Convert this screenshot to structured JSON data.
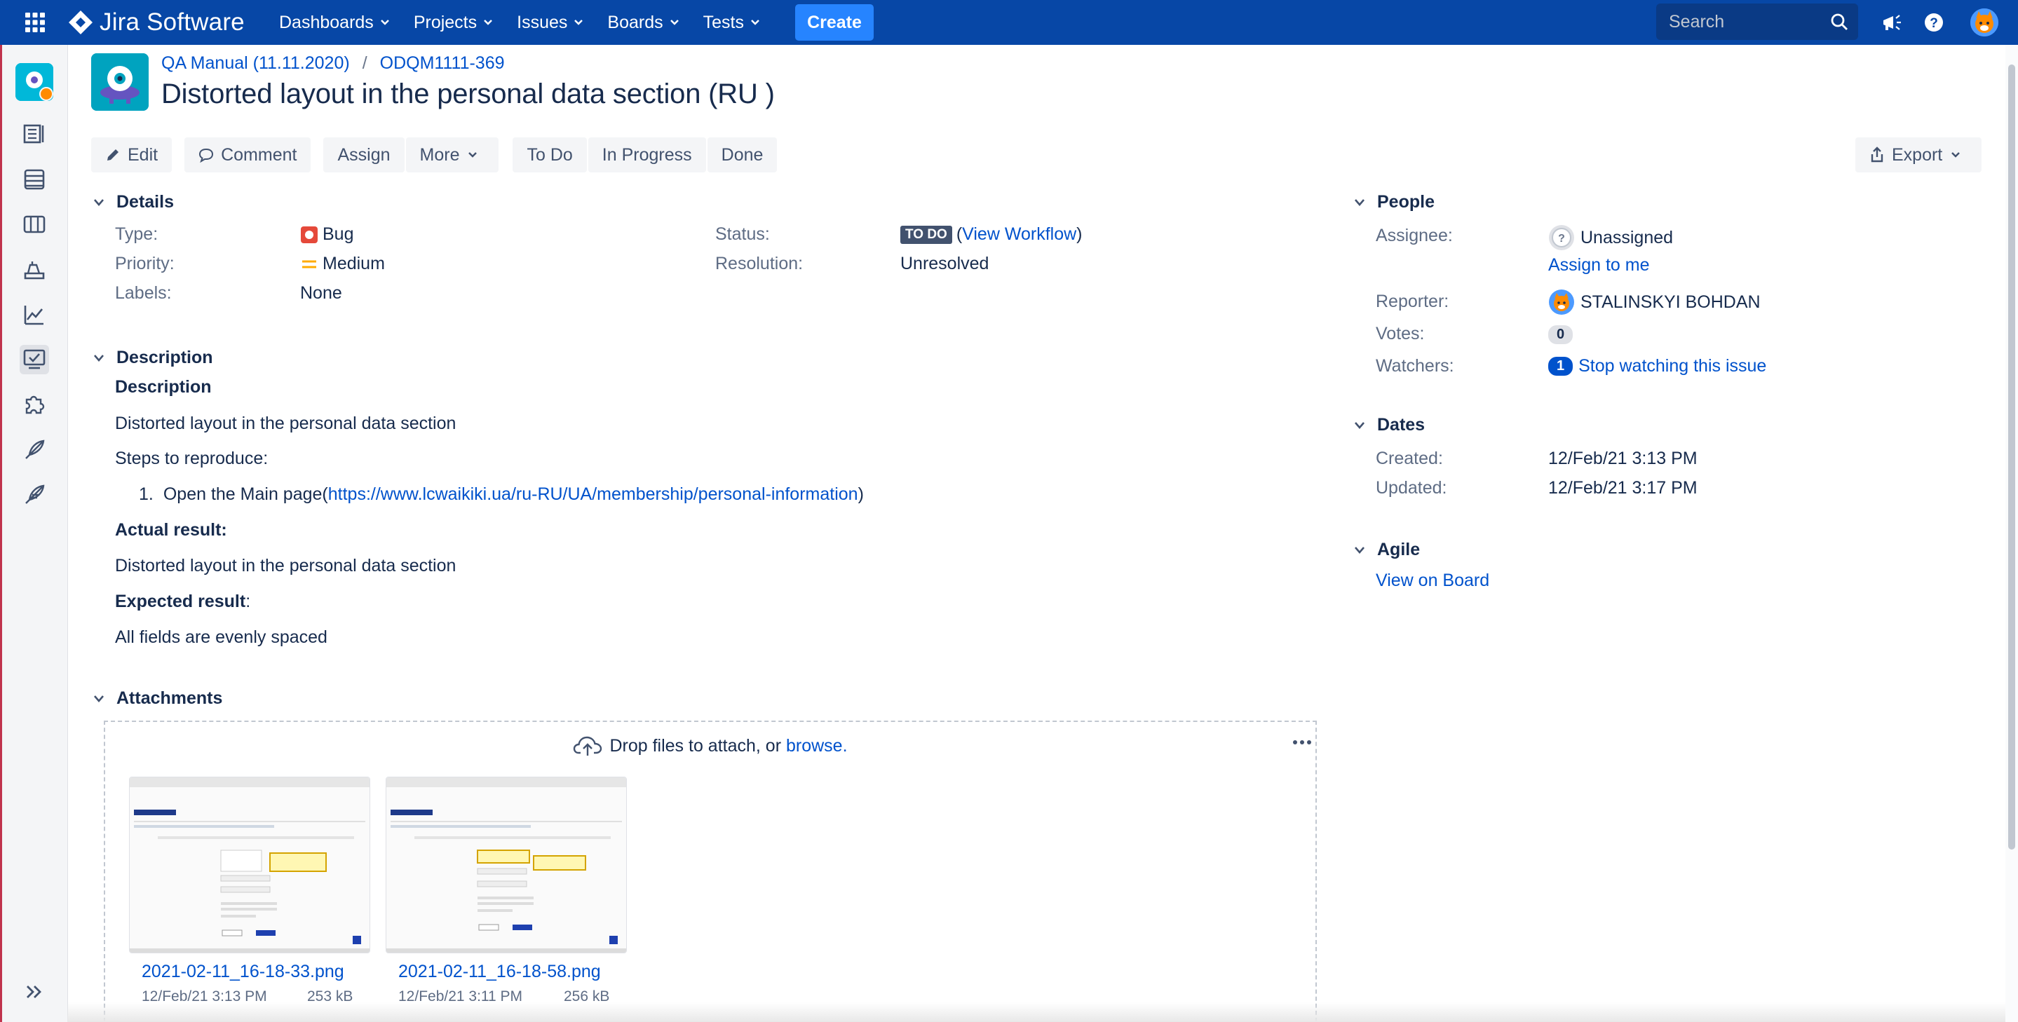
{
  "app": {
    "name": "Jira Software",
    "nav": [
      "Dashboards",
      "Projects",
      "Issues",
      "Boards",
      "Tests"
    ],
    "create_label": "Create",
    "search_placeholder": "Search"
  },
  "sidebar": {
    "icons": [
      "project-avatar",
      "backlog-icon",
      "board-list-icon",
      "board-columns-icon",
      "releases-icon",
      "reports-icon",
      "tests-icon",
      "add-ons-icon",
      "feather-icon",
      "feather-alt-icon",
      "expand-icon"
    ]
  },
  "issue": {
    "project": "QA Manual (11.11.2020)",
    "key": "ODQM1111-369",
    "title": "Distorted layout in the personal data section (RU )"
  },
  "toolbar": {
    "edit": "Edit",
    "comment": "Comment",
    "assign": "Assign",
    "more": "More",
    "todo": "To Do",
    "in_progress": "In Progress",
    "done": "Done",
    "export": "Export"
  },
  "details": {
    "heading": "Details",
    "type_label": "Type:",
    "type_value": "Bug",
    "priority_label": "Priority:",
    "priority_value": "Medium",
    "labels_label": "Labels:",
    "labels_value": "None",
    "status_label": "Status:",
    "status_lozenge": "TO DO",
    "status_open": "(",
    "status_link": "View Workflow",
    "status_close": ")",
    "resolution_label": "Resolution:",
    "resolution_value": "Unresolved"
  },
  "description": {
    "heading": "Description",
    "sub_heading": "Description",
    "line1": "Distorted layout in the personal data section",
    "steps_label": "Steps to reproduce:",
    "step1_num": "1.",
    "step1_text": "Open the Main page(",
    "step1_link": "https://www.lcwaikiki.ua/ru-RU/UA/membership/personal-information",
    "step1_close": ")",
    "actual_label": "Actual result:",
    "actual_text": "Distorted layout in the personal data section",
    "expected_label": "Expected result",
    "expected_colon": ":",
    "expected_text": "All fields are evenly spaced"
  },
  "attachments": {
    "heading": "Attachments",
    "drop_text": "Drop files to attach, or",
    "browse": "browse.",
    "files": [
      {
        "name": "2021-02-11_16-18-33.png",
        "date": "12/Feb/21 3:13 PM",
        "size": "253 kB"
      },
      {
        "name": "2021-02-11_16-18-58.png",
        "date": "12/Feb/21 3:11 PM",
        "size": "256 kB"
      }
    ]
  },
  "people": {
    "heading": "People",
    "assignee_label": "Assignee:",
    "assignee_value": "Unassigned",
    "assign_to_me": "Assign to me",
    "reporter_label": "Reporter:",
    "reporter_value": "STALINSKYI BOHDAN",
    "votes_label": "Votes:",
    "votes_value": "0",
    "watchers_label": "Watchers:",
    "watchers_count": "1",
    "watchers_link": "Stop watching this issue"
  },
  "dates": {
    "heading": "Dates",
    "created_label": "Created:",
    "created_value": "12/Feb/21 3:13 PM",
    "updated_label": "Updated:",
    "updated_value": "12/Feb/21 3:17 PM"
  },
  "agile": {
    "heading": "Agile",
    "link": "View on Board"
  },
  "colors": {
    "topbar": "#0747a6",
    "link": "#0052cc",
    "bug": "#e5493a",
    "priority": "#ffab00"
  }
}
